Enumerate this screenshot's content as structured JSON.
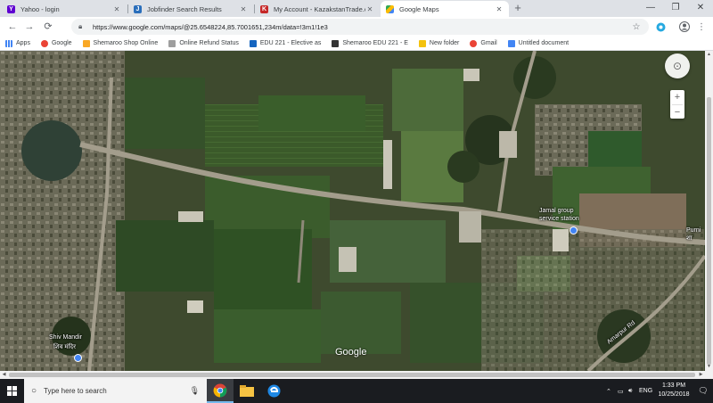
{
  "tabs": [
    {
      "label": "Yahoo - login",
      "favicon_color": "#5f01d1",
      "favicon_letter": "Y"
    },
    {
      "label": "Jobfinder Search Results",
      "favicon_color": "#2a6ebb",
      "favicon_letter": "J"
    },
    {
      "label": "My Account - KazakstanTrade.com",
      "favicon_color": "#c62828",
      "favicon_letter": "K"
    },
    {
      "label": "Google Maps",
      "favicon_color": "#34a853",
      "favicon_letter": ""
    }
  ],
  "toolbar": {
    "url": "https://www.google.com/maps/@25.6548224,85.7001651,234m/data=!3m1!1e3"
  },
  "bookmarks": [
    {
      "label": "Apps",
      "color": "#4285f4"
    },
    {
      "label": "Google",
      "color": "#ea4335"
    },
    {
      "label": "Shemaroo Shop Online",
      "color": "#f9a825"
    },
    {
      "label": "Online Refund Status",
      "color": "#9e9e9e"
    },
    {
      "label": "EDU 221 - Elective as",
      "color": "#1565c0"
    },
    {
      "label": "Shemaroo EDU 221 - E",
      "color": "#333333"
    },
    {
      "label": "New folder",
      "color": "#f4c20d"
    },
    {
      "label": "Gmail",
      "color": "#ea4335"
    },
    {
      "label": "Untitled document",
      "color": "#4285f4"
    }
  ],
  "map": {
    "labels": {
      "station": "Jamal group\nservice station",
      "shiv_mandir": "Shiv Mandir",
      "shiv_mandir_hindi": "शिव मंदिर",
      "road": "Amarpur Rd",
      "right_edge": "Purni\nशा"
    },
    "watermark": "Google",
    "compass": "⊙",
    "zoom_in": "+",
    "zoom_out": "−"
  },
  "taskbar": {
    "search_placeholder": "Type here to search",
    "language": "ENG",
    "time": "1:33 PM",
    "date": "10/25/2018"
  }
}
